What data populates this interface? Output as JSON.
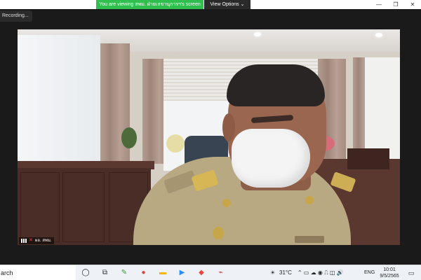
{
  "topbar": {
    "viewing_banner": "You are viewing สพม. ฝ่ายเลขานุการฯ's screen",
    "view_options_label": "View Options",
    "view_options_chevron": "⌄",
    "window_controls": {
      "minimize": "—",
      "restore": "❐",
      "close": "✕"
    }
  },
  "recording": {
    "label": "Recording..."
  },
  "video": {
    "participant_name": "ผอ. สพม."
  },
  "taskbar": {
    "search_text": "arch",
    "apps": [
      {
        "name": "search-circle-icon",
        "glyph": "◯",
        "color": "#222222"
      },
      {
        "name": "task-view-icon",
        "glyph": "⧉",
        "color": "#333333"
      },
      {
        "name": "paint-app-icon",
        "glyph": "✎",
        "color": "#3a9a3a"
      },
      {
        "name": "chrome-icon",
        "glyph": "●",
        "color": "#db4437"
      },
      {
        "name": "file-explorer-icon",
        "glyph": "▬",
        "color": "#f4b400"
      },
      {
        "name": "zoom-icon",
        "glyph": "▶",
        "color": "#2d8cff"
      },
      {
        "name": "anydesk-icon",
        "glyph": "◆",
        "color": "#ef443b"
      },
      {
        "name": "acrobat-icon",
        "glyph": "⌁",
        "color": "#c62828"
      }
    ],
    "weather_icon": "☀",
    "temperature": "31°C",
    "tray_icons": "⌃ ▭ ☁ ◉ ⎍ ◫ 🔊",
    "language": "ENG",
    "time": "10:01",
    "date": "9/5/2565",
    "notification_icon": "▭"
  }
}
